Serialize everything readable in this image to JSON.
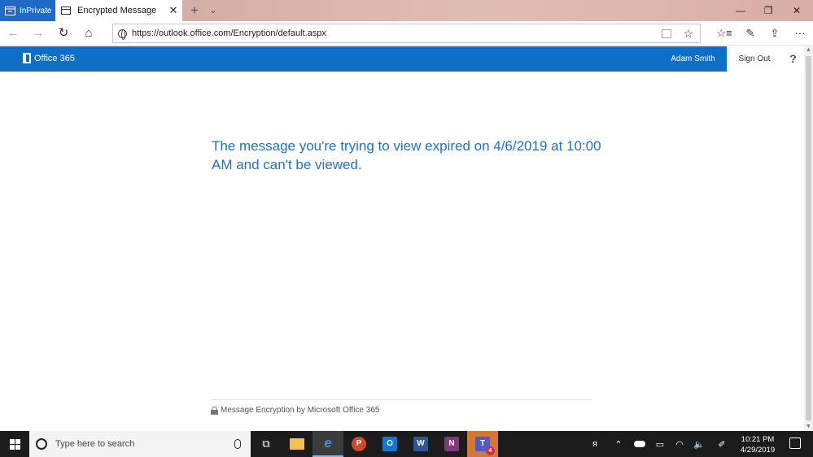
{
  "browser": {
    "inprivate_label": "InPrivate",
    "tab_title": "Encrypted Message",
    "tab_close_glyph": "✕",
    "new_tab_glyph": "+",
    "tab_menu_glyph": "⌄",
    "window_controls": {
      "minimize": "—",
      "restore": "❐",
      "close": "✕"
    },
    "nav": {
      "back": "←",
      "forward": "→",
      "refresh": "↻",
      "home": "⌂"
    },
    "url": "https://outlook.office.com/Encryption/default.aspx",
    "favorite_glyph": "☆",
    "toolbar_icons": [
      {
        "name": "favorites-hub-icon",
        "glyph": "☆≡"
      },
      {
        "name": "notes-pen-icon",
        "glyph": "✎"
      },
      {
        "name": "share-icon",
        "glyph": "⇪"
      },
      {
        "name": "more-options-icon",
        "glyph": "···"
      }
    ]
  },
  "office_header": {
    "logo_text": "Office 365",
    "user_name": "Adam Smith",
    "sign_out": "Sign Out",
    "help": "?"
  },
  "content": {
    "message": "The message you're trying to view expired on 4/6/2019 at 10:00 AM and can't be viewed.",
    "footer": "Message Encryption by Microsoft Office 365"
  },
  "taskbar": {
    "search_placeholder": "Type here to search",
    "apps": [
      {
        "name": "task-view",
        "label": "⧉"
      },
      {
        "name": "file-explorer",
        "label": ""
      },
      {
        "name": "edge",
        "label": "e"
      },
      {
        "name": "powerpoint",
        "label": "P"
      },
      {
        "name": "outlook",
        "label": "O"
      },
      {
        "name": "word",
        "label": "W"
      },
      {
        "name": "onenote",
        "label": "N"
      },
      {
        "name": "teams",
        "label": "T"
      }
    ],
    "teams_badge": "4",
    "tray_glyphs": {
      "people": "ᴙ",
      "chevron": "⌃",
      "battery": "▭",
      "wifi": "◠",
      "volume": "🔈",
      "pen": "✐"
    },
    "time": "10:21 PM",
    "date": "4/29/2019"
  },
  "colors": {
    "office_blue": "#0f6fc6",
    "message_blue": "#2272c3",
    "inprivate_blue": "#2169c6",
    "taskbar": "#1c1c1c"
  }
}
